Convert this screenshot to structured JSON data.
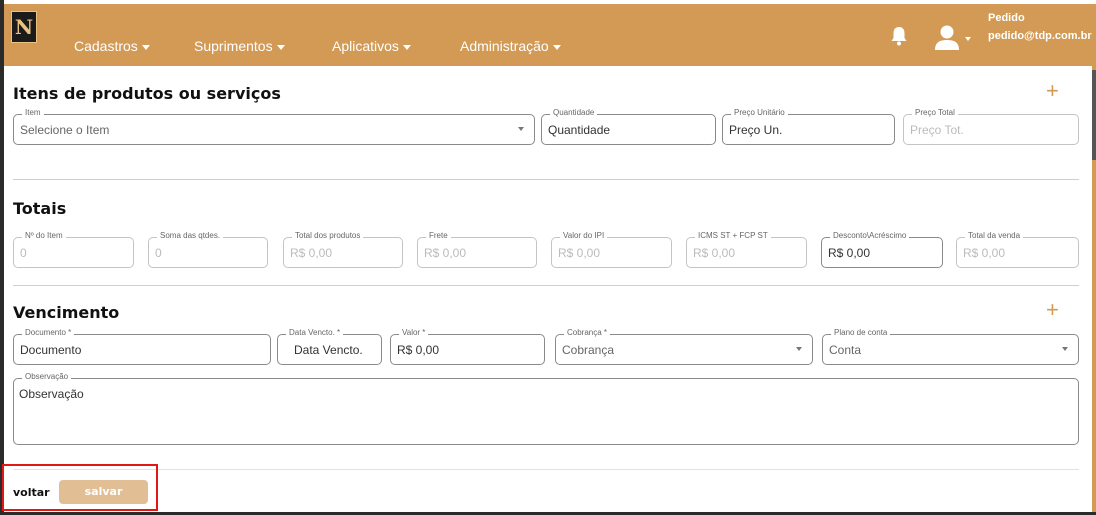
{
  "navbar": {
    "logo_text": "N",
    "menu": [
      {
        "label": "Cadastros"
      },
      {
        "label": "Suprimentos"
      },
      {
        "label": "Aplicativos"
      },
      {
        "label": "Administração"
      }
    ],
    "user_name": "Pedido",
    "user_email": "pedido@tdp.com.br",
    "accent_color": "#d29a55"
  },
  "itens": {
    "title": "Itens de produtos ou serviços",
    "fields": [
      {
        "label": "Item",
        "value": "Selecione o Item"
      },
      {
        "label": "Quantidade",
        "value": "Quantidade"
      },
      {
        "label": "Preço Unitário",
        "value": "Preço Un."
      },
      {
        "label": "Preço Total",
        "value": "Preço Tot."
      }
    ]
  },
  "totais": {
    "title": "Totais",
    "fields": [
      {
        "label": "Nº do Item",
        "value": "0"
      },
      {
        "label": "Soma das qtdes.",
        "value": "0"
      },
      {
        "label": "Total dos produtos",
        "value": "R$ 0,00"
      },
      {
        "label": "Frete",
        "value": "R$ 0,00"
      },
      {
        "label": "Valor do IPI",
        "value": "R$ 0,00"
      },
      {
        "label": "ICMS ST + FCP ST",
        "value": "R$ 0,00"
      },
      {
        "label": "Desconto\\Acréscimo",
        "value": "R$ 0,00"
      },
      {
        "label": "Total da venda",
        "value": "R$ 0,00"
      }
    ]
  },
  "vencimento": {
    "title": "Vencimento",
    "fields": [
      {
        "label": "Documento *",
        "value": "Documento"
      },
      {
        "label": "Data Vencto. *",
        "value": "Data Vencto."
      },
      {
        "label": "Valor *",
        "value": "R$ 0,00"
      },
      {
        "label": "Cobrança *",
        "value": "Cobrança"
      },
      {
        "label": "Plano de conta",
        "value": "Conta"
      },
      {
        "label": "Observação",
        "value": "Observação"
      }
    ]
  },
  "footer": {
    "voltar_label": "voltar",
    "salvar_label": "salvar"
  }
}
